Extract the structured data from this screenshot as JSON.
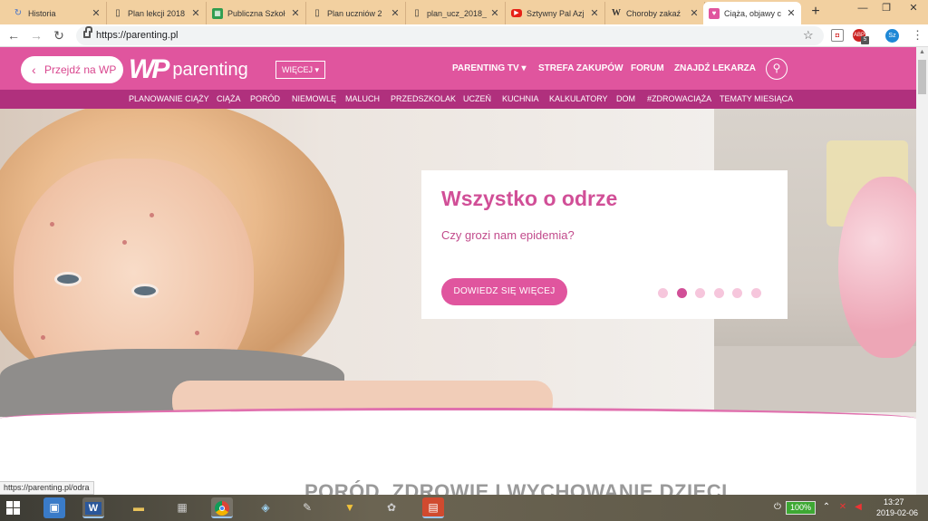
{
  "browser": {
    "tabs": [
      {
        "label": "Historia",
        "icon": "history-icon",
        "active": false
      },
      {
        "label": "Plan lekcji 2018",
        "icon": "document-icon",
        "active": false
      },
      {
        "label": "Publiczna Szkoł",
        "icon": "sheets-icon",
        "active": false
      },
      {
        "label": "Plan uczniów 2",
        "icon": "document-icon",
        "active": false
      },
      {
        "label": "plan_ucz_2018_",
        "icon": "document-icon",
        "active": false
      },
      {
        "label": "Sztywny Pal Azj",
        "icon": "youtube-icon",
        "active": false
      },
      {
        "label": "Choroby zakaź",
        "icon": "wikipedia-icon",
        "active": false
      },
      {
        "label": "Ciąża, objawy c",
        "icon": "heart-icon",
        "active": true
      }
    ],
    "new_tab_label": "+",
    "url": "https://parenting.pl",
    "status_url": "https://parenting.pl/odra",
    "profile_initials": "Sz",
    "ext_badge": "5",
    "ext_label": "ABP"
  },
  "site": {
    "back_label": "Przejdź na WP",
    "logo_wp": "WP",
    "logo_text": "parenting",
    "more_label": "WIĘCEJ ▾",
    "top_nav": [
      "PARENTING TV ▾",
      "STREFA ZAKUPÓW",
      "FORUM",
      "ZNAJDŹ LEKARZA"
    ],
    "sub_nav": [
      "PLANOWANIE CIĄŻY",
      "CIĄŻA",
      "PORÓD",
      "NIEMOWLĘ",
      "MALUCH",
      "PRZEDSZKOLAK",
      "UCZEŃ",
      "KUCHNIA",
      "KALKULATORY",
      "DOM",
      "#ZDROWACIĄŻA",
      "TEMATY MIESIĄCA"
    ],
    "hero": {
      "title": "Wszystko o odrze",
      "subtitle": "Czy grozi nam epidemia?",
      "cta": "DOWIEDZ SIĘ WIĘCEJ",
      "slides": 6,
      "active_slide": 2
    },
    "section_title": "PORÓD, ZDROWIE I WYCHOWANIE DZIECI"
  },
  "taskbar": {
    "battery": "100%",
    "time": "13:27",
    "date": "2019-02-06"
  },
  "colors": {
    "brand": "#e0559e",
    "brand_dark": "#b0307d",
    "tabstrip": "#f2d0a0"
  }
}
